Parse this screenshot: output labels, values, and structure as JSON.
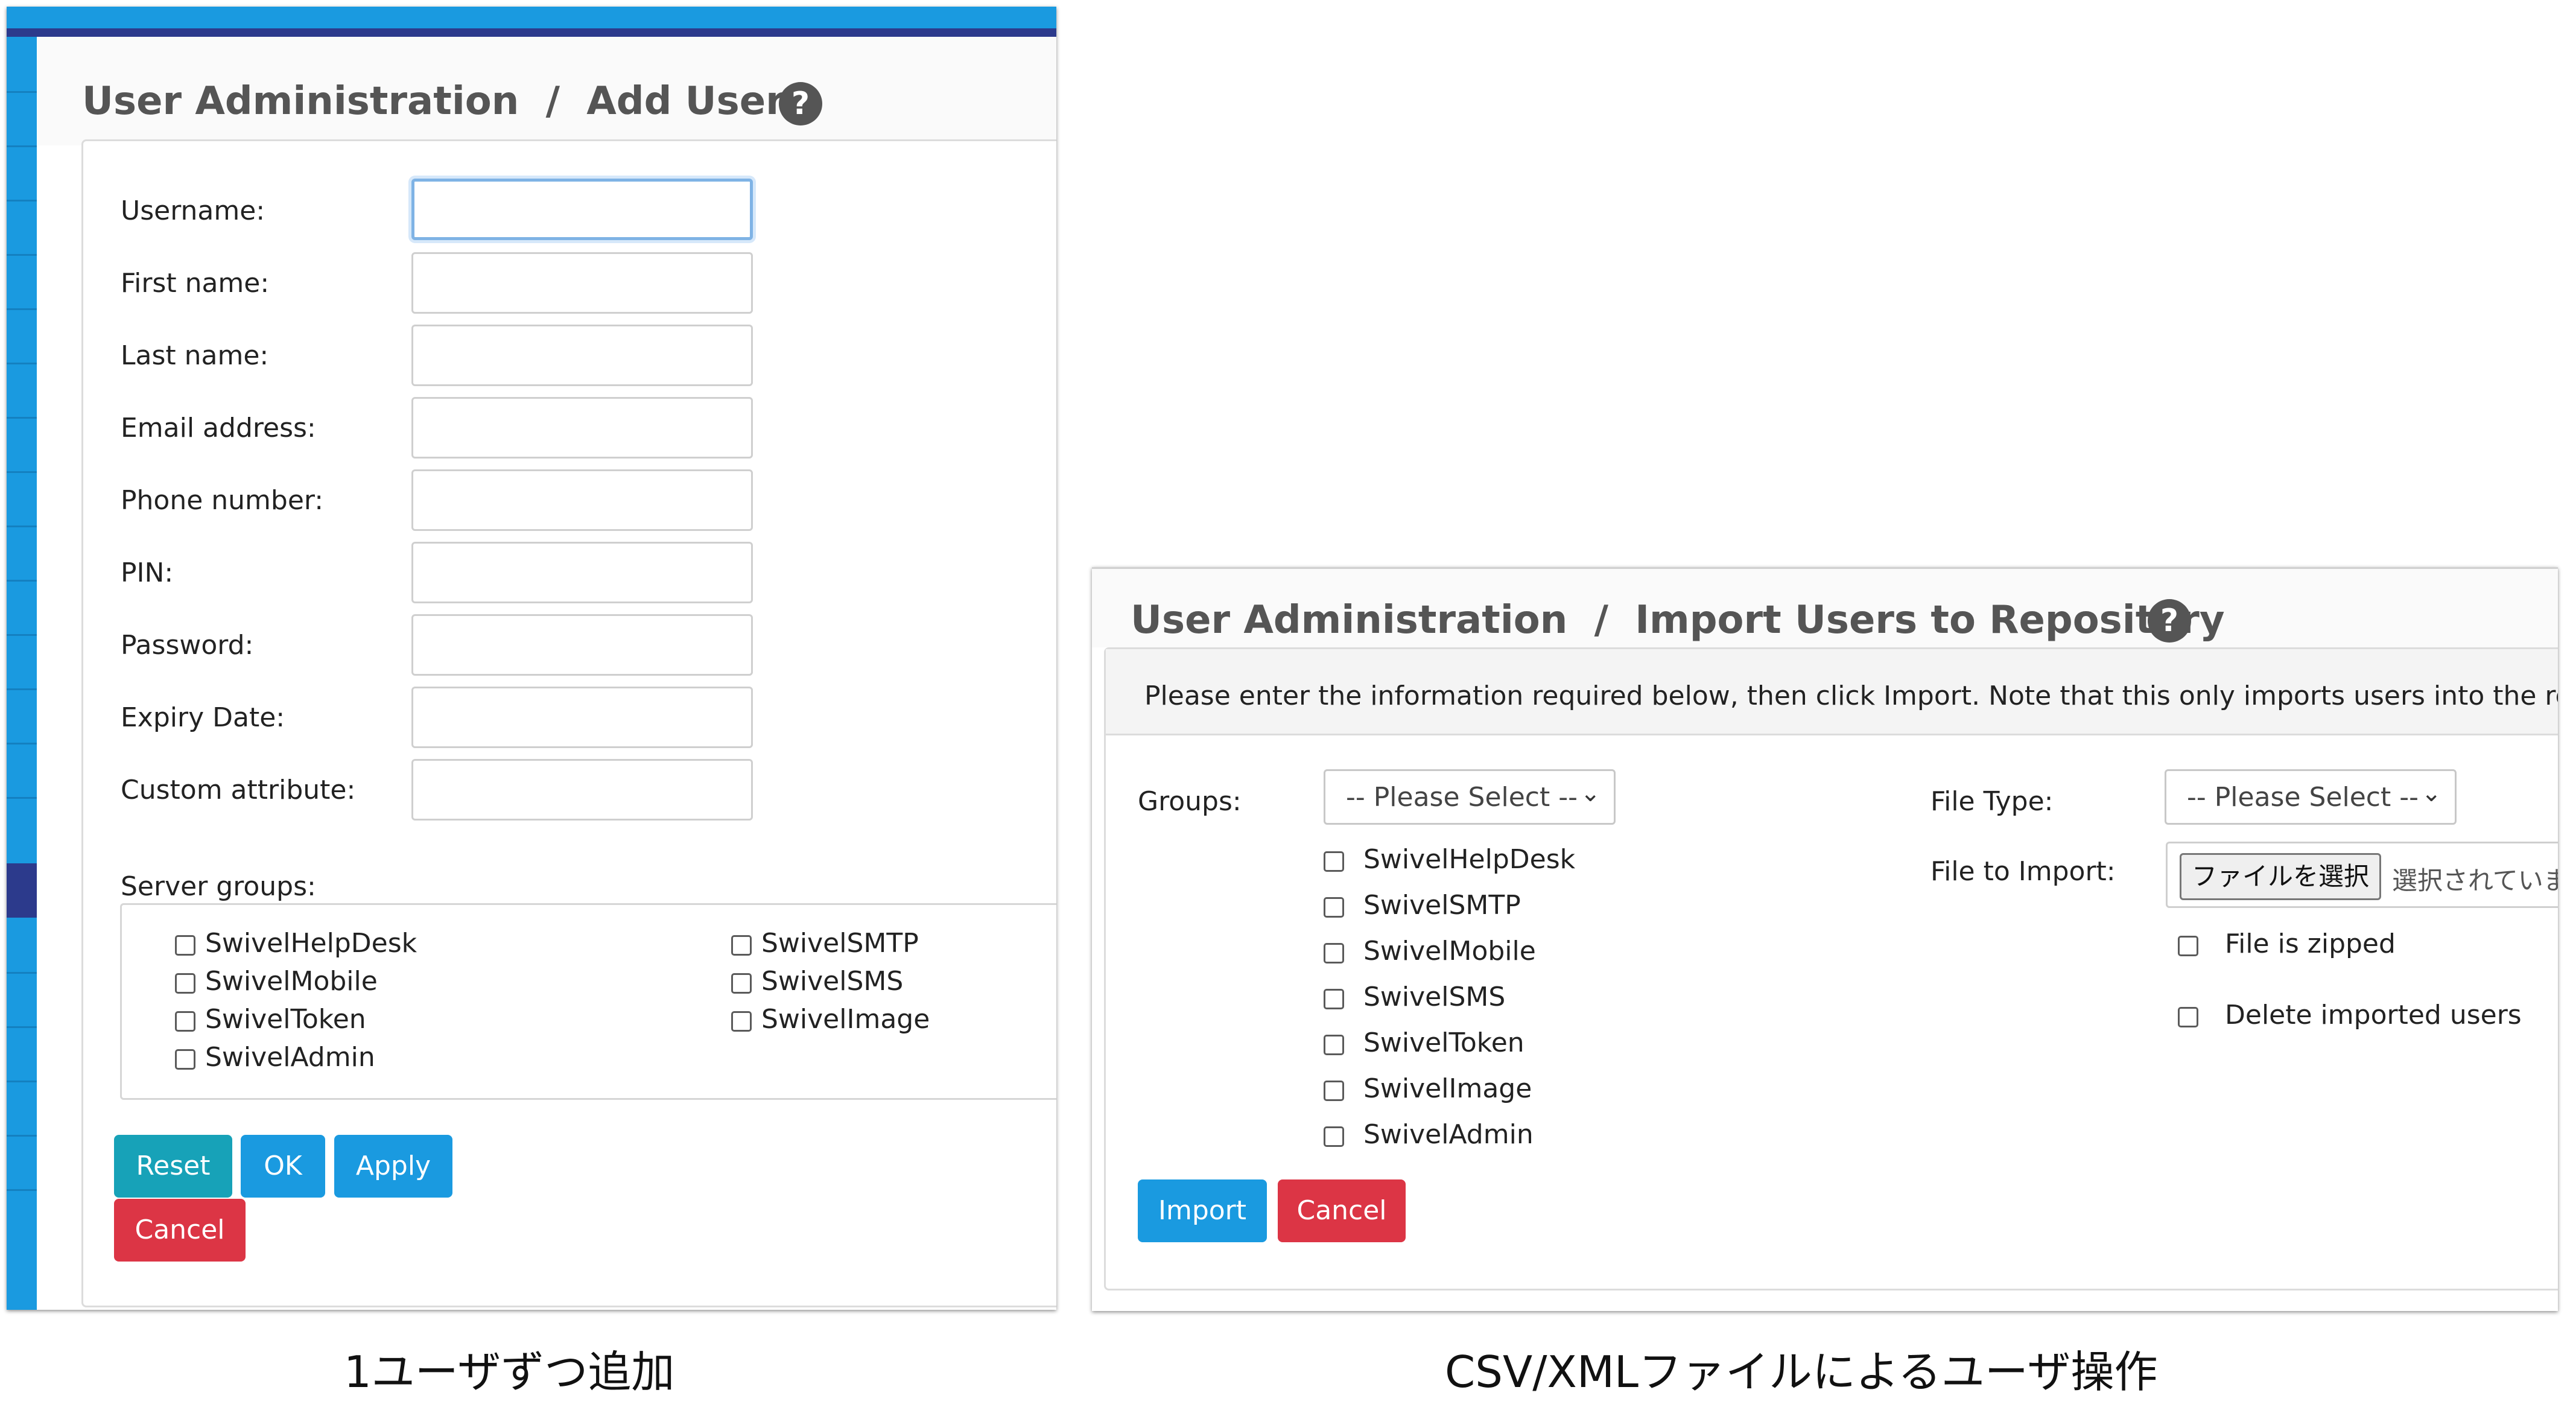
{
  "add_user": {
    "breadcrumb_section": "User Administration",
    "separator": "/",
    "page_name": "Add User",
    "help_glyph": "?",
    "fields": [
      {
        "label": "Username:",
        "value": "",
        "focused": true
      },
      {
        "label": "First name:",
        "value": ""
      },
      {
        "label": "Last name:",
        "value": ""
      },
      {
        "label": "Email address:",
        "value": ""
      },
      {
        "label": "Phone number:",
        "value": ""
      },
      {
        "label": "PIN:",
        "value": ""
      },
      {
        "label": "Password:",
        "value": ""
      },
      {
        "label": "Expiry Date:",
        "value": ""
      },
      {
        "label": "Custom attribute:",
        "value": ""
      }
    ],
    "server_groups_label": "Server groups:",
    "server_groups": [
      "SwivelHelpDesk",
      "SwivelSMTP",
      "SwivelMobile",
      "SwivelSMS",
      "SwivelToken",
      "SwivelImage",
      "SwivelAdmin"
    ],
    "buttons": {
      "reset": "Reset",
      "ok": "OK",
      "apply": "Apply",
      "cancel": "Cancel"
    }
  },
  "import_users": {
    "breadcrumb_section": "User Administration",
    "separator": "/",
    "page_name": "Import Users to Repository",
    "help_glyph": "?",
    "notice": "Please enter the information required below, then click Import. Note that this only imports users into the repositor",
    "groups_label": "Groups:",
    "groups_select": "-- Please Select --",
    "groups": [
      "SwivelHelpDesk",
      "SwivelSMTP",
      "SwivelMobile",
      "SwivelSMS",
      "SwivelToken",
      "SwivelImage",
      "SwivelAdmin"
    ],
    "file_type_label": "File Type:",
    "file_type_select": "-- Please Select --",
    "file_to_import_label": "File to Import:",
    "file_button": "ファイルを選択",
    "file_status": "選択されていま",
    "file_is_zipped": "File is zipped",
    "delete_imported_users": "Delete imported users",
    "buttons": {
      "import": "Import",
      "cancel": "Cancel"
    }
  },
  "captions": {
    "left": "1ユーザずつ追加",
    "right": "CSV/XMLファイルによるユーザ操作"
  },
  "colors": {
    "accent_blue": "#1a9ae0",
    "navy": "#2c3a8c",
    "teal": "#17a2b8",
    "danger_red": "#dc3545"
  }
}
